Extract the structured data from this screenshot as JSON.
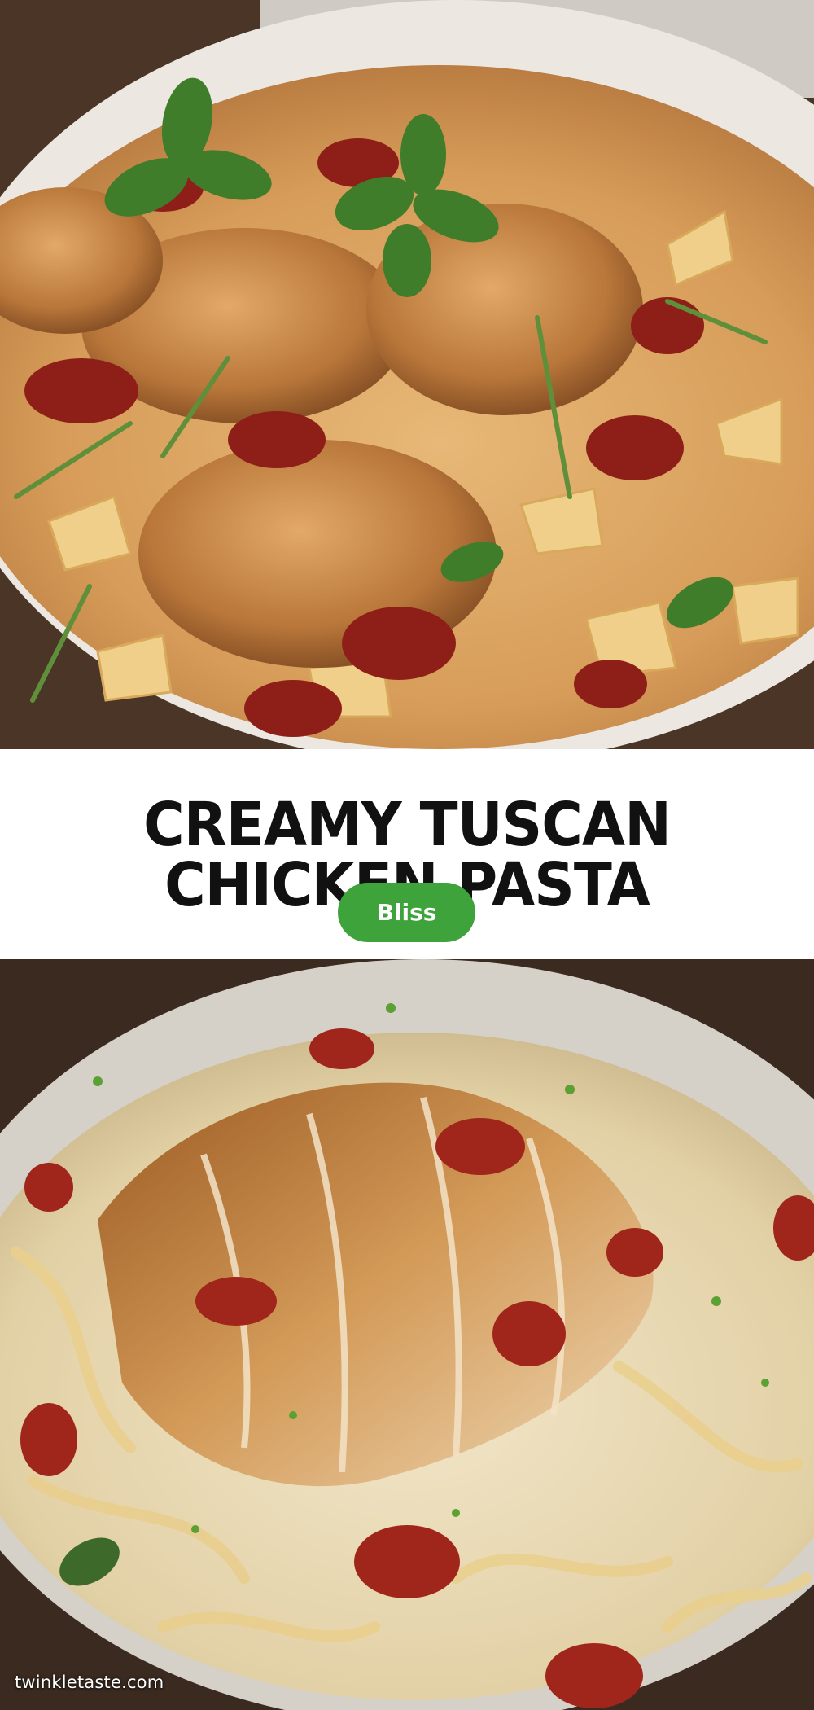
{
  "recipe": {
    "title": "CREAMY TUSCAN CHICKEN PASTA",
    "badge_label": "Bliss",
    "watermark": "twinkletaste.com"
  },
  "images": {
    "top": "bowtie pasta with seared chicken, sun-dried tomatoes, basil and parmesan",
    "bottom": "fettuccine alfredo with sliced seared chicken and sun-dried tomatoes"
  },
  "colors": {
    "badge": "#3ea33b",
    "title": "#111111",
    "background": "#ffffff"
  }
}
